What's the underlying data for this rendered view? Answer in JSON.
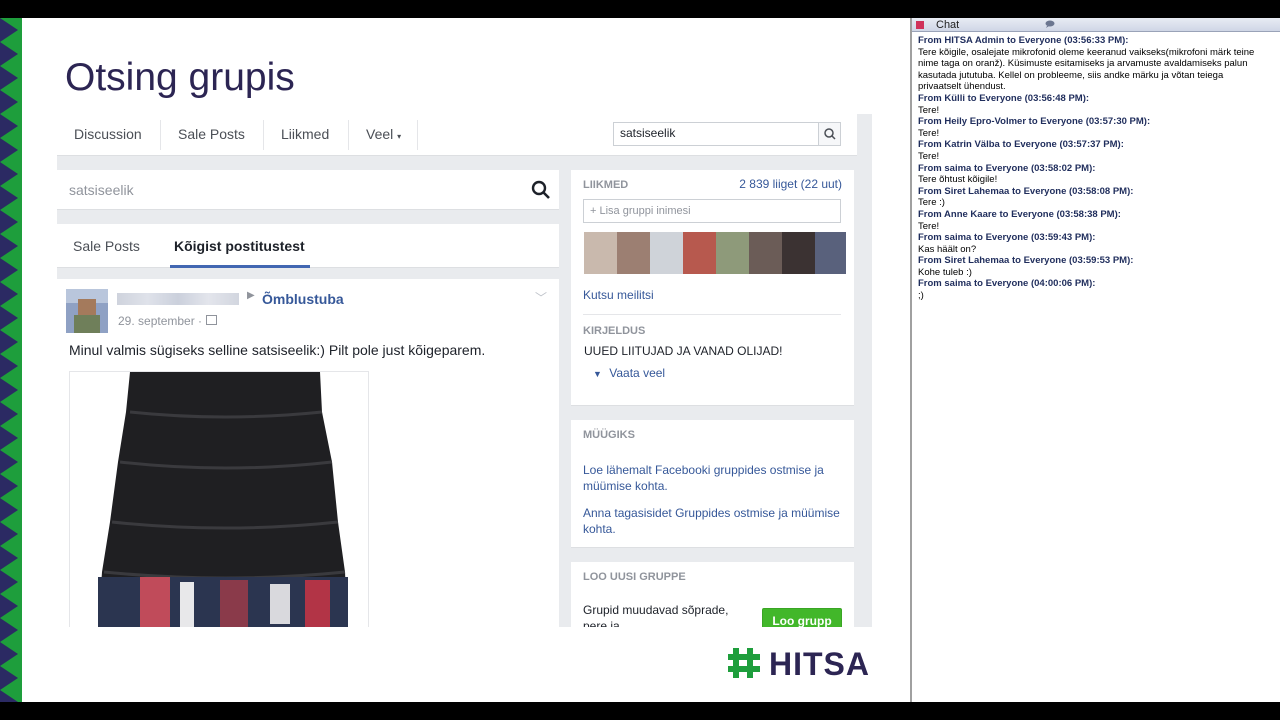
{
  "slide": {
    "title": "Otsing grupis"
  },
  "facebook": {
    "nav": {
      "tabs": [
        "Discussion",
        "Sale Posts",
        "Liikmed",
        "Veel"
      ],
      "search_value": "satsiseelik"
    },
    "main_search": {
      "value": "satsiseelik"
    },
    "result_tabs": {
      "items": [
        "Sale Posts",
        "Kõigist postitustest"
      ],
      "active": "Kõigist postitustest"
    },
    "post": {
      "group_name": "Õmblustuba",
      "date": "29. september ·",
      "text": "Minul valmis sügiseks selline satsiseelik:) Pilt pole just kõigeparem."
    },
    "sidebar": {
      "members": {
        "heading": "LIIKMED",
        "count": "2 839 liiget (22 uut)",
        "add_placeholder": "+ Lisa gruppi inimesi",
        "invite_link": "Kutsu meilitsi"
      },
      "description": {
        "heading": "KIRJELDUS",
        "text": "UUED LIITUJAD JA VANAD OLIJAD!",
        "see_more": "Vaata veel"
      },
      "selling": {
        "heading": "MÜÜGIKS",
        "link1": "Loe lähemalt Facebooki gruppides ostmise ja müümise kohta.",
        "link2": "Anna tagasisidet Gruppides ostmise ja müümise kohta."
      },
      "create_group": {
        "heading": "LOO UUSI GRUPPE",
        "text": "Grupid muudavad sõprade, pere ja meeskonnakaaslastega",
        "button": "Loo grupp"
      }
    }
  },
  "logo": {
    "text": "HITSA",
    "color": "#2c2553",
    "hash_color": "#1e9e3c"
  },
  "chat": {
    "title": "Chat",
    "messages": [
      {
        "from": "From HITSA Admin to Everyone (03:56:33 PM):",
        "text": "Tere kõigile, osalejate mikrofonid oleme keeranud vaikseks(mikrofoni märk teine nime taga on oranž). Küsimuste esitamiseks ja arvamuste avaldamiseks palun kasutada jututuba. Kellel on probleeme, siis andke märku ja võtan teiega privaatselt ühendust."
      },
      {
        "from": "From Külli to Everyone (03:56:48 PM):",
        "text": "Tere!"
      },
      {
        "from": "From Heily Epro-Volmer to Everyone (03:57:30 PM):",
        "text": "Tere!"
      },
      {
        "from": "From Katrin Välba to Everyone (03:57:37 PM):",
        "text": "Tere!"
      },
      {
        "from": "From saima to Everyone (03:58:02 PM):",
        "text": "Tere õhtust kõigile!"
      },
      {
        "from": "From Siret Lahemaa to Everyone (03:58:08 PM):",
        "text": "Tere :)"
      },
      {
        "from": "From Anne Kaare to Everyone (03:58:38 PM):",
        "text": "Tere!"
      },
      {
        "from": "From saima to Everyone (03:59:43 PM):",
        "text": "Kas häält on?"
      },
      {
        "from": "From Siret Lahemaa to Everyone (03:59:53 PM):",
        "text": "Kohe tuleb :)"
      },
      {
        "from": "From saima to Everyone (04:00:06 PM):",
        "text": ";)"
      }
    ]
  }
}
